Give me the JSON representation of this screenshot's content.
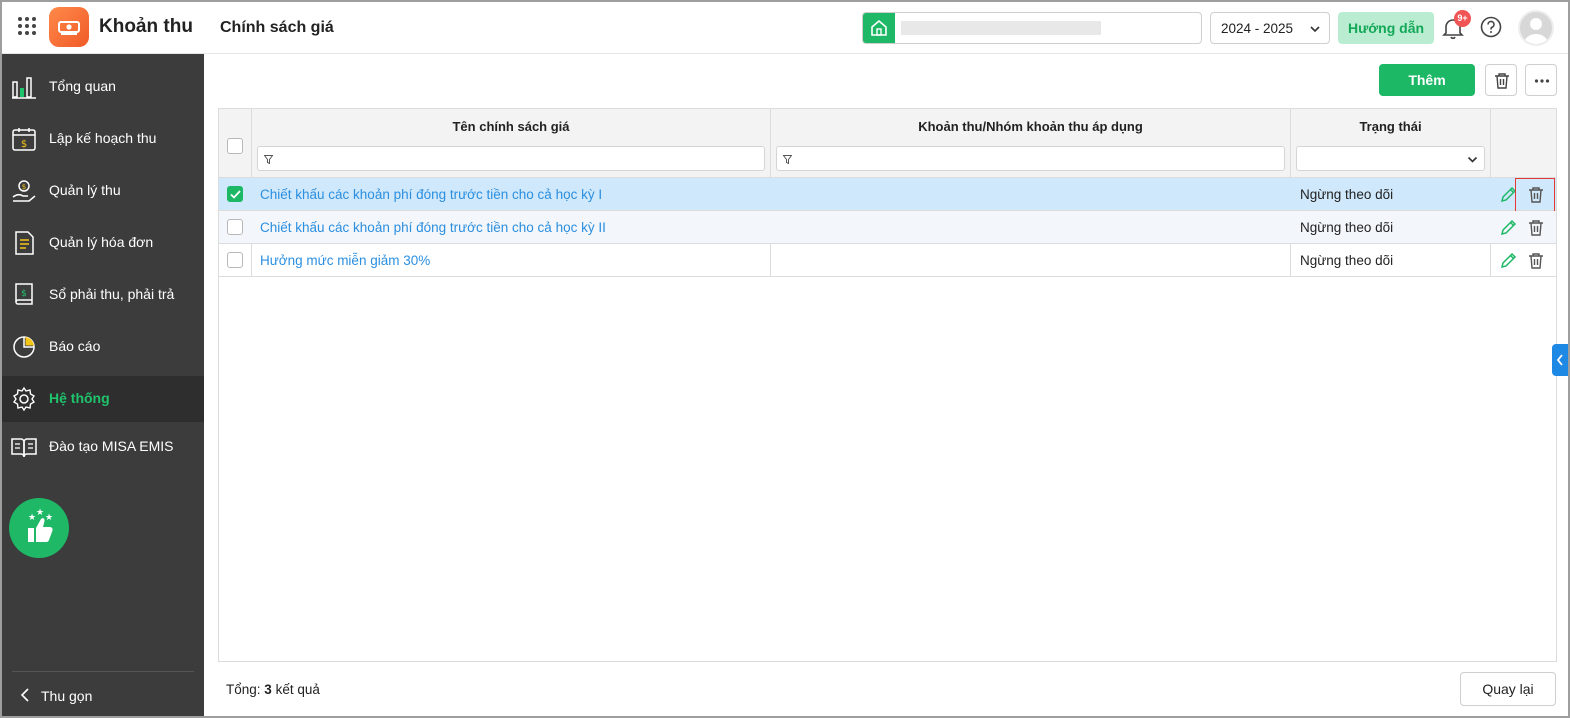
{
  "app": {
    "title": "Khoản thu",
    "page_title": "Chính sách giá"
  },
  "header": {
    "school_name": "",
    "school_year": "2024 - 2025",
    "guide_label": "Hướng dẫn",
    "notification_badge": "9+"
  },
  "sidebar": {
    "items": [
      {
        "label": "Tổng quan",
        "icon": "chart-bars-icon"
      },
      {
        "label": "Lập kế hoạch thu",
        "icon": "calendar-dollar-icon"
      },
      {
        "label": "Quản lý thu",
        "icon": "hand-coin-icon"
      },
      {
        "label": "Quản lý hóa đơn",
        "icon": "invoice-icon"
      },
      {
        "label": "Sổ phải thu, phải trả",
        "icon": "ledger-book-icon"
      },
      {
        "label": "Báo cáo",
        "icon": "pie-chart-icon"
      },
      {
        "label": "Hệ thống",
        "icon": "gear-icon",
        "active": true
      },
      {
        "label": "Đào tạo MISA EMIS",
        "icon": "open-book-icon"
      }
    ],
    "collapse_label": "Thu gọn"
  },
  "toolbar": {
    "add_label": "Thêm"
  },
  "table": {
    "columns": [
      "Tên chính sách giá",
      "Khoản thu/Nhóm khoản thu áp dụng",
      "Trạng thái"
    ],
    "rows": [
      {
        "name": "Chiết khấu các khoản phí đóng trước tiền cho cả học kỳ I",
        "applied": "",
        "status": "Ngừng theo dõi",
        "checked": true
      },
      {
        "name": "Chiết khấu các khoản phí đóng trước tiền cho cả học kỳ II",
        "applied": "",
        "status": "Ngừng theo dõi",
        "checked": false
      },
      {
        "name": "Hưởng mức miễn giảm 30%",
        "applied": "",
        "status": "Ngừng theo dõi",
        "checked": false
      }
    ]
  },
  "footer": {
    "total_prefix": "Tổng:",
    "total_count": "3",
    "total_suffix": "kết quả",
    "back_label": "Quay lại"
  },
  "colors": {
    "accent": "#1cb866",
    "link": "#2b8fe0",
    "sidebar_bg": "#3c3c3c",
    "selected_row": "#cfe8fb",
    "highlight": "#e53935"
  }
}
